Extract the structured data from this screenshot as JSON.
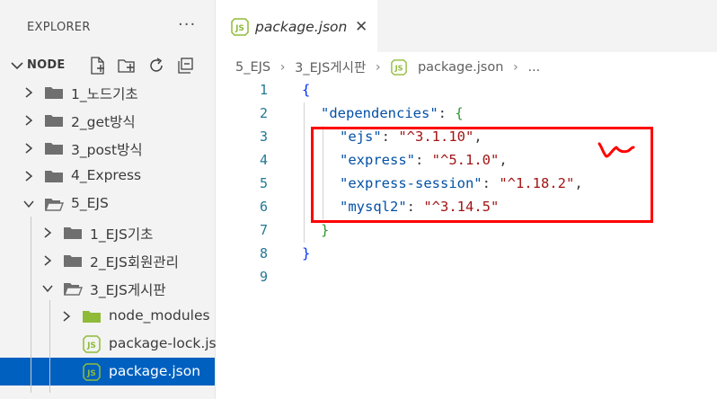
{
  "explorer": {
    "title": "EXPLORER",
    "more": "···",
    "section_title": "NODE",
    "tree": [
      {
        "label": "1_노드기초",
        "type": "folder",
        "state": "collapsed"
      },
      {
        "label": "2_get방식",
        "type": "folder",
        "state": "collapsed"
      },
      {
        "label": "3_post방식",
        "type": "folder",
        "state": "collapsed"
      },
      {
        "label": "4_Express",
        "type": "folder",
        "state": "collapsed"
      },
      {
        "label": "5_EJS",
        "type": "folder",
        "state": "expanded"
      },
      {
        "label": "1_EJS기초",
        "type": "folder",
        "state": "collapsed"
      },
      {
        "label": "2_EJS회원관리",
        "type": "folder",
        "state": "collapsed"
      },
      {
        "label": "3_EJS게시판",
        "type": "folder",
        "state": "expanded"
      },
      {
        "label": "node_modules",
        "type": "folder-green",
        "state": "collapsed"
      },
      {
        "label": "package-lock.js...",
        "type": "json-file"
      },
      {
        "label": "package.json",
        "type": "json-file",
        "selected": true
      }
    ]
  },
  "editor": {
    "tab": {
      "label": "package.json",
      "icon": "json-file-icon",
      "close": "✕"
    },
    "breadcrumb": [
      "5_EJS",
      "3_EJS게시판",
      "package.json",
      "..."
    ],
    "line_numbers": [
      "1",
      "2",
      "3",
      "4",
      "5",
      "6",
      "7",
      "8",
      "9"
    ],
    "code": {
      "l1_open": "{",
      "l2_key": "\"dependencies\"",
      "l2_colon": ": ",
      "l2_open": "{",
      "deps": [
        {
          "key": "\"ejs\"",
          "value": "\"^3.1.10\"",
          "comma": ","
        },
        {
          "key": "\"express\"",
          "value": "\"^5.1.0\"",
          "comma": ","
        },
        {
          "key": "\"express-session\"",
          "value": "\"^1.18.2\"",
          "comma": ","
        },
        {
          "key": "\"mysql2\"",
          "value": "\"^3.14.5\"",
          "comma": ""
        }
      ],
      "dep_colon": ": ",
      "l7_close": "}",
      "l8_close": "}"
    }
  },
  "colors": {
    "selection": "#0060c0",
    "annotation": "#ff0000",
    "json_key": "#0451a5",
    "json_string": "#a31515",
    "line_number": "#237893"
  }
}
